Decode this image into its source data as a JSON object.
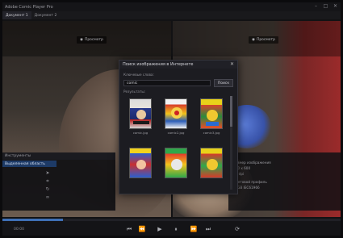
{
  "window": {
    "title": "Adobe Comic Player Pro",
    "buttons": [
      "–",
      "□",
      "✕"
    ]
  },
  "tabs": [
    {
      "label": "Документ 1",
      "active": true
    },
    {
      "label": "Документ 2",
      "active": false
    }
  ],
  "viewers": {
    "left_chip": "Просмотр",
    "right_chip": "Просмотр"
  },
  "dialog": {
    "title": "Поиск изображения в Интернете",
    "close": "✕",
    "search_label": "Ключевые слова:",
    "search_value": "comic",
    "search_button": "Поиск",
    "results_label": "Результаты:",
    "results": [
      {
        "caption": "comic.jpg"
      },
      {
        "caption": "comic2.jpg"
      },
      {
        "caption": "comic3.jpg"
      },
      {
        "caption": ""
      },
      {
        "caption": ""
      },
      {
        "caption": ""
      }
    ]
  },
  "tools": {
    "header": "Инструменты",
    "selected": "Выделенная область",
    "icons": [
      "cursor-icon",
      "crop-icon",
      "rotate-icon",
      "link-icon"
    ]
  },
  "info": {
    "lines": [
      "Размер изображения",
      "800 x 600",
      "72 dpi",
      "Цветовой профиль",
      "sRGB IEC61966"
    ]
  },
  "transport": {
    "label": "00:00",
    "progress": 0.18,
    "icons": [
      "prev-icon",
      "rewind-icon",
      "play-icon",
      "pause-icon",
      "forward-icon",
      "next-icon",
      "loop-icon"
    ]
  },
  "colors": {
    "accent": "#3e6fb5",
    "selection": "#1d3a66",
    "red_panel": "#9b2b2b"
  }
}
